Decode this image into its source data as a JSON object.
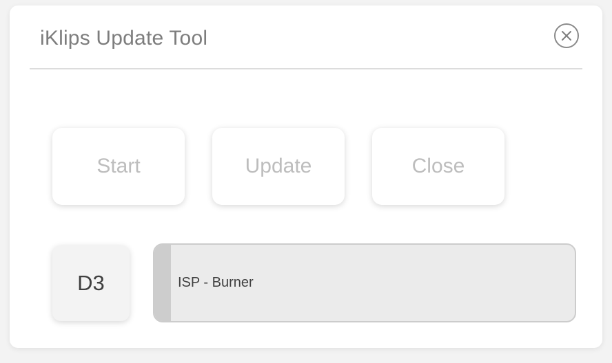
{
  "window": {
    "title": "iKlips Update Tool",
    "close_icon": "close-circle-icon"
  },
  "buttons": {
    "start_label": "Start",
    "update_label": "Update",
    "close_label": "Close"
  },
  "device": {
    "badge": "D3"
  },
  "progress": {
    "label": "ISP - Burner",
    "fraction": 0.04
  },
  "colors": {
    "button_text_disabled": "#bdbdbd",
    "progress_fill": "#cdcdcd",
    "progress_track": "#ebebeb"
  }
}
